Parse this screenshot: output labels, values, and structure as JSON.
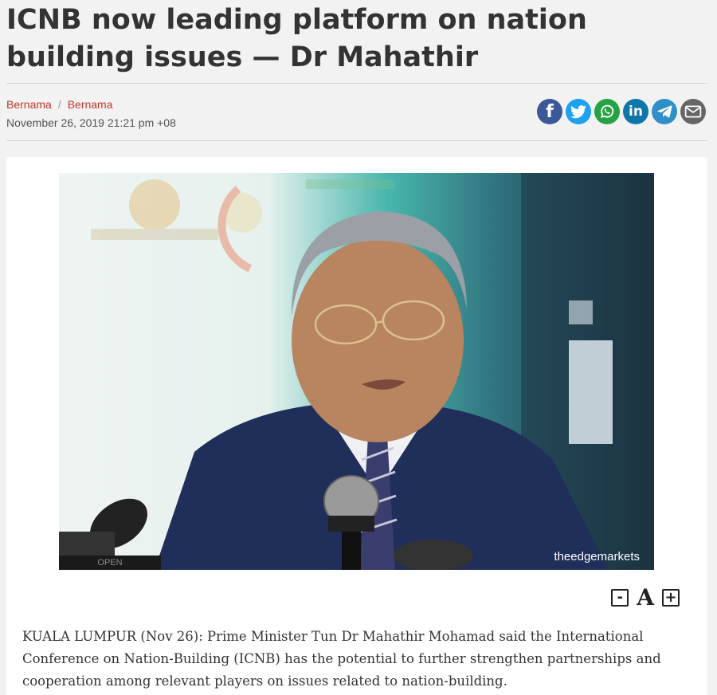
{
  "article": {
    "title": "ICNB now leading platform on nation building issues — Dr Mahathir",
    "author_1": "Bernama",
    "author_sep": "/",
    "author_2": "Bernama",
    "date": "November 26, 2019 21:21 pm +08"
  },
  "share": [
    {
      "icon": "facebook-icon",
      "glyph": "f",
      "color": "#3b5998"
    },
    {
      "icon": "twitter-icon",
      "glyph": "t",
      "color": "#1da1f2"
    },
    {
      "icon": "whatsapp-icon",
      "glyph": "w",
      "color": "#25a244"
    },
    {
      "icon": "linkedin-icon",
      "glyph": "in",
      "color": "#0e76a8"
    },
    {
      "icon": "telegram-icon",
      "glyph": "➤",
      "color": "#2f8fc8"
    },
    {
      "icon": "email-icon",
      "glyph": "✉",
      "color": "#666666"
    }
  ],
  "photo": {
    "credit": "theedgemarkets",
    "open_label": "OPEN"
  },
  "font_controls": {
    "decrease": "-",
    "label": "A",
    "increase": "+"
  },
  "body": {
    "paragraph_1": "KUALA LUMPUR (Nov 26): Prime Minister Tun Dr Mahathir Mohamad said the International Conference on Nation-Building (ICNB) has the potential to further strengthen partnerships and cooperation among relevant players on issues related to nation-building."
  },
  "colors": {
    "background": "#f2f2f2",
    "author_link": "#c0392b",
    "text": "#333333"
  }
}
